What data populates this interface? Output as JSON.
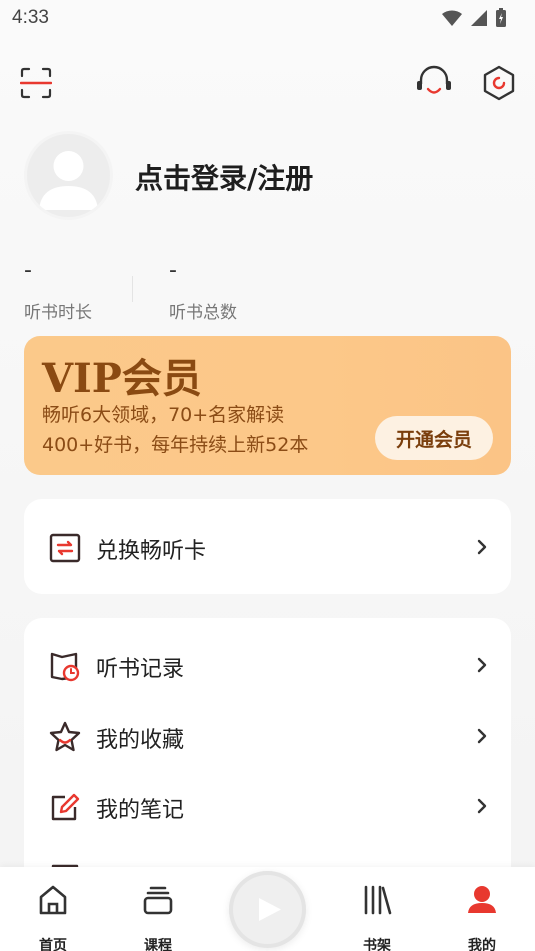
{
  "status_bar": {
    "time": "4:33"
  },
  "profile": {
    "login_label": "点击登录/注册"
  },
  "stats": [
    {
      "value": "-",
      "label": "听书时长"
    },
    {
      "value": "-",
      "label": "听书总数"
    }
  ],
  "vip": {
    "title": "VIP会员",
    "line1": "畅听6大领域，70+名家解读",
    "line2": "400+好书，每年持续上新52本",
    "button": "开通会员"
  },
  "redeem": {
    "label": "兑换畅听卡"
  },
  "menu": [
    {
      "label": "听书记录",
      "icon": "history-icon"
    },
    {
      "label": "我的收藏",
      "icon": "star-icon"
    },
    {
      "label": "我的笔记",
      "icon": "edit-icon"
    }
  ],
  "nav": {
    "home": "首页",
    "courses": "课程",
    "bookshelf": "书架",
    "mine": "我的"
  },
  "colors": {
    "accent": "#e8382f",
    "vip_bg": "#fbc98a",
    "vip_text": "#8a4a12"
  }
}
